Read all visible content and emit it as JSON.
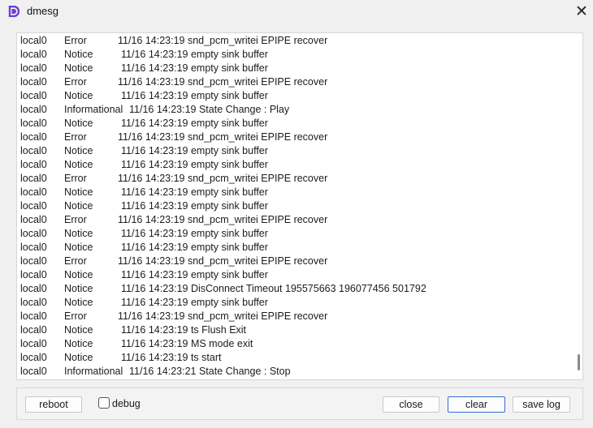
{
  "window": {
    "title": "dmesg",
    "icon": "app-d-icon",
    "close_icon": "close-icon",
    "accent": "#6c3cd6"
  },
  "log": [
    {
      "src": "local0",
      "level": "Error",
      "text": "11/16 14:23:19 snd_pcm_writei EPIPE recover"
    },
    {
      "src": "local0",
      "level": "Notice",
      "text": "11/16 14:23:19 empty sink buffer"
    },
    {
      "src": "local0",
      "level": "Notice",
      "text": "11/16 14:23:19 empty sink buffer"
    },
    {
      "src": "local0",
      "level": "Error",
      "text": "11/16 14:23:19 snd_pcm_writei EPIPE recover"
    },
    {
      "src": "local0",
      "level": "Notice",
      "text": "11/16 14:23:19 empty sink buffer"
    },
    {
      "src": "local0",
      "level": "Informational",
      "text": "11/16 14:23:19 State Change : Play"
    },
    {
      "src": "local0",
      "level": "Notice",
      "text": "11/16 14:23:19 empty sink buffer"
    },
    {
      "src": "local0",
      "level": "Error",
      "text": "11/16 14:23:19 snd_pcm_writei EPIPE recover"
    },
    {
      "src": "local0",
      "level": "Notice",
      "text": "11/16 14:23:19 empty sink buffer"
    },
    {
      "src": "local0",
      "level": "Notice",
      "text": "11/16 14:23:19 empty sink buffer"
    },
    {
      "src": "local0",
      "level": "Error",
      "text": "11/16 14:23:19 snd_pcm_writei EPIPE recover"
    },
    {
      "src": "local0",
      "level": "Notice",
      "text": "11/16 14:23:19 empty sink buffer"
    },
    {
      "src": "local0",
      "level": "Notice",
      "text": "11/16 14:23:19 empty sink buffer"
    },
    {
      "src": "local0",
      "level": "Error",
      "text": "11/16 14:23:19 snd_pcm_writei EPIPE recover"
    },
    {
      "src": "local0",
      "level": "Notice",
      "text": "11/16 14:23:19 empty sink buffer"
    },
    {
      "src": "local0",
      "level": "Notice",
      "text": "11/16 14:23:19 empty sink buffer"
    },
    {
      "src": "local0",
      "level": "Error",
      "text": "11/16 14:23:19 snd_pcm_writei EPIPE recover"
    },
    {
      "src": "local0",
      "level": "Notice",
      "text": "11/16 14:23:19 empty sink buffer"
    },
    {
      "src": "local0",
      "level": "Notice",
      "text": "11/16 14:23:19 DisConnect Timeout 195575663 196077456 501792"
    },
    {
      "src": "local0",
      "level": "Notice",
      "text": "11/16 14:23:19 empty sink buffer"
    },
    {
      "src": "local0",
      "level": "Error",
      "text": "11/16 14:23:19 snd_pcm_writei EPIPE recover"
    },
    {
      "src": "local0",
      "level": "Notice",
      "text": "11/16 14:23:19 ts Flush Exit"
    },
    {
      "src": "local0",
      "level": "Notice",
      "text": "11/16 14:23:19 MS mode exit"
    },
    {
      "src": "local0",
      "level": "Notice",
      "text": "11/16 14:23:19 ts start"
    },
    {
      "src": "local0",
      "level": "Informational",
      "text": "11/16 14:23:21 State Change : Stop"
    }
  ],
  "buttons": {
    "reboot": "reboot",
    "debug": "debug",
    "close": "close",
    "clear": "clear",
    "save_log": "save log"
  },
  "debug_checked": false
}
